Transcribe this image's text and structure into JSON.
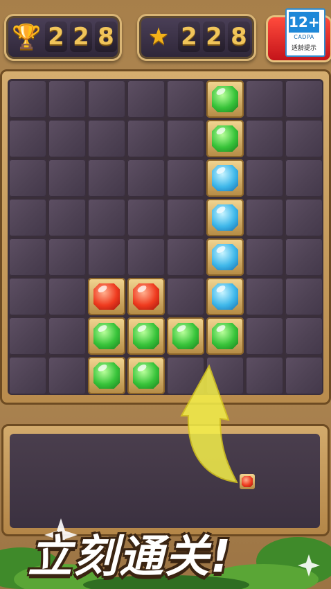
{
  "top_bar": {
    "best_score": {
      "icon": "trophy-icon",
      "digits": [
        "2",
        "2",
        "8"
      ]
    },
    "current_score": {
      "icon": "star-icon",
      "digits": [
        "2",
        "2",
        "8"
      ]
    },
    "age_rating": {
      "number": "12+",
      "org": "CADPA",
      "tip": "适龄提示"
    }
  },
  "board": {
    "rows": 8,
    "cols": 8,
    "gems": [
      {
        "row": 0,
        "col": 5,
        "color": "green"
      },
      {
        "row": 1,
        "col": 5,
        "color": "green"
      },
      {
        "row": 2,
        "col": 5,
        "color": "blue"
      },
      {
        "row": 3,
        "col": 5,
        "color": "blue"
      },
      {
        "row": 4,
        "col": 5,
        "color": "blue"
      },
      {
        "row": 5,
        "col": 5,
        "color": "blue"
      },
      {
        "row": 5,
        "col": 2,
        "color": "red"
      },
      {
        "row": 5,
        "col": 3,
        "color": "red"
      },
      {
        "row": 6,
        "col": 2,
        "color": "green"
      },
      {
        "row": 6,
        "col": 3,
        "color": "green"
      },
      {
        "row": 6,
        "col": 4,
        "color": "green"
      },
      {
        "row": 6,
        "col": 5,
        "color": "green"
      },
      {
        "row": 7,
        "col": 2,
        "color": "green"
      },
      {
        "row": 7,
        "col": 3,
        "color": "green"
      }
    ]
  },
  "tray": {
    "piece": {
      "color": "red"
    }
  },
  "banner": {
    "text": "立刻通关!"
  },
  "colors": {
    "green": "#38c43a",
    "blue": "#3fb8ea",
    "red": "#ef3b1f",
    "gold": "#f1c55a"
  }
}
